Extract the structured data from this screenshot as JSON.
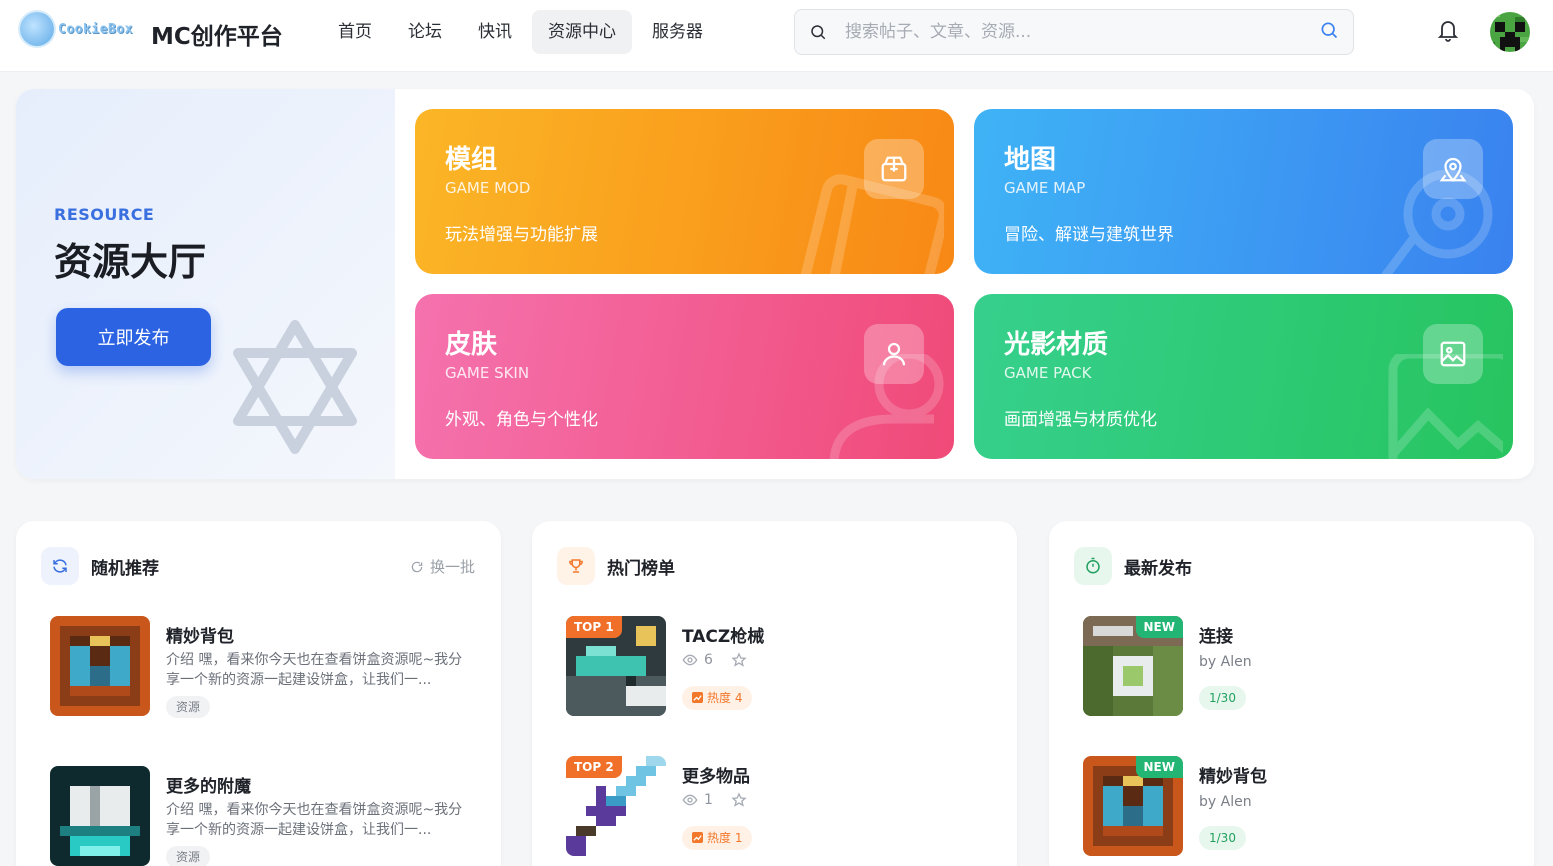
{
  "header": {
    "logo_text": "CookieBox",
    "site_title": "MC创作平台",
    "nav": [
      "首页",
      "论坛",
      "快讯",
      "资源中心",
      "服务器"
    ],
    "active_nav": "资源中心",
    "search_placeholder": "搜索帖子、文章、资源..."
  },
  "hero": {
    "subtitle": "RESOURCE",
    "title": "资源大厅",
    "publish_label": "立即发布",
    "categories": [
      {
        "title": "模组",
        "en": "GAME MOD",
        "desc": "玩法增强与功能扩展",
        "icon": "package-icon"
      },
      {
        "title": "地图",
        "en": "GAME MAP",
        "desc": "冒险、解谜与建筑世界",
        "icon": "map-pin-icon"
      },
      {
        "title": "皮肤",
        "en": "GAME SKIN",
        "desc": "外观、角色与个性化",
        "icon": "user-icon"
      },
      {
        "title": "光影材质",
        "en": "GAME PACK",
        "desc": "画面增强与材质优化",
        "icon": "image-icon"
      }
    ]
  },
  "random": {
    "title": "随机推荐",
    "refresh_label": "换一批",
    "items": [
      {
        "title": "精妙背包",
        "desc": "介绍 嘿，看来你今天也在查看饼盒资源呢~我分享一个新的资源一起建设饼盒，让我们一...",
        "tag": "资源"
      },
      {
        "title": "更多的附魔",
        "desc": "介绍 嘿，看来你今天也在查看饼盒资源呢~我分享一个新的资源一起建设饼盒，让我们一...",
        "tag": "资源"
      }
    ]
  },
  "hot": {
    "title": "热门榜单",
    "items": [
      {
        "badge": "TOP 1",
        "title": "TACZ枪械",
        "views": "6",
        "heat": "热度 4"
      },
      {
        "badge": "TOP 2",
        "title": "更多物品",
        "views": "1",
        "heat": "热度 1"
      }
    ]
  },
  "latest": {
    "title": "最新发布",
    "items": [
      {
        "badge": "NEW",
        "title": "连接",
        "author": "by Alen",
        "date": "1/30"
      },
      {
        "badge": "NEW",
        "title": "精妙背包",
        "author": "by Alen",
        "date": "1/30"
      }
    ]
  }
}
